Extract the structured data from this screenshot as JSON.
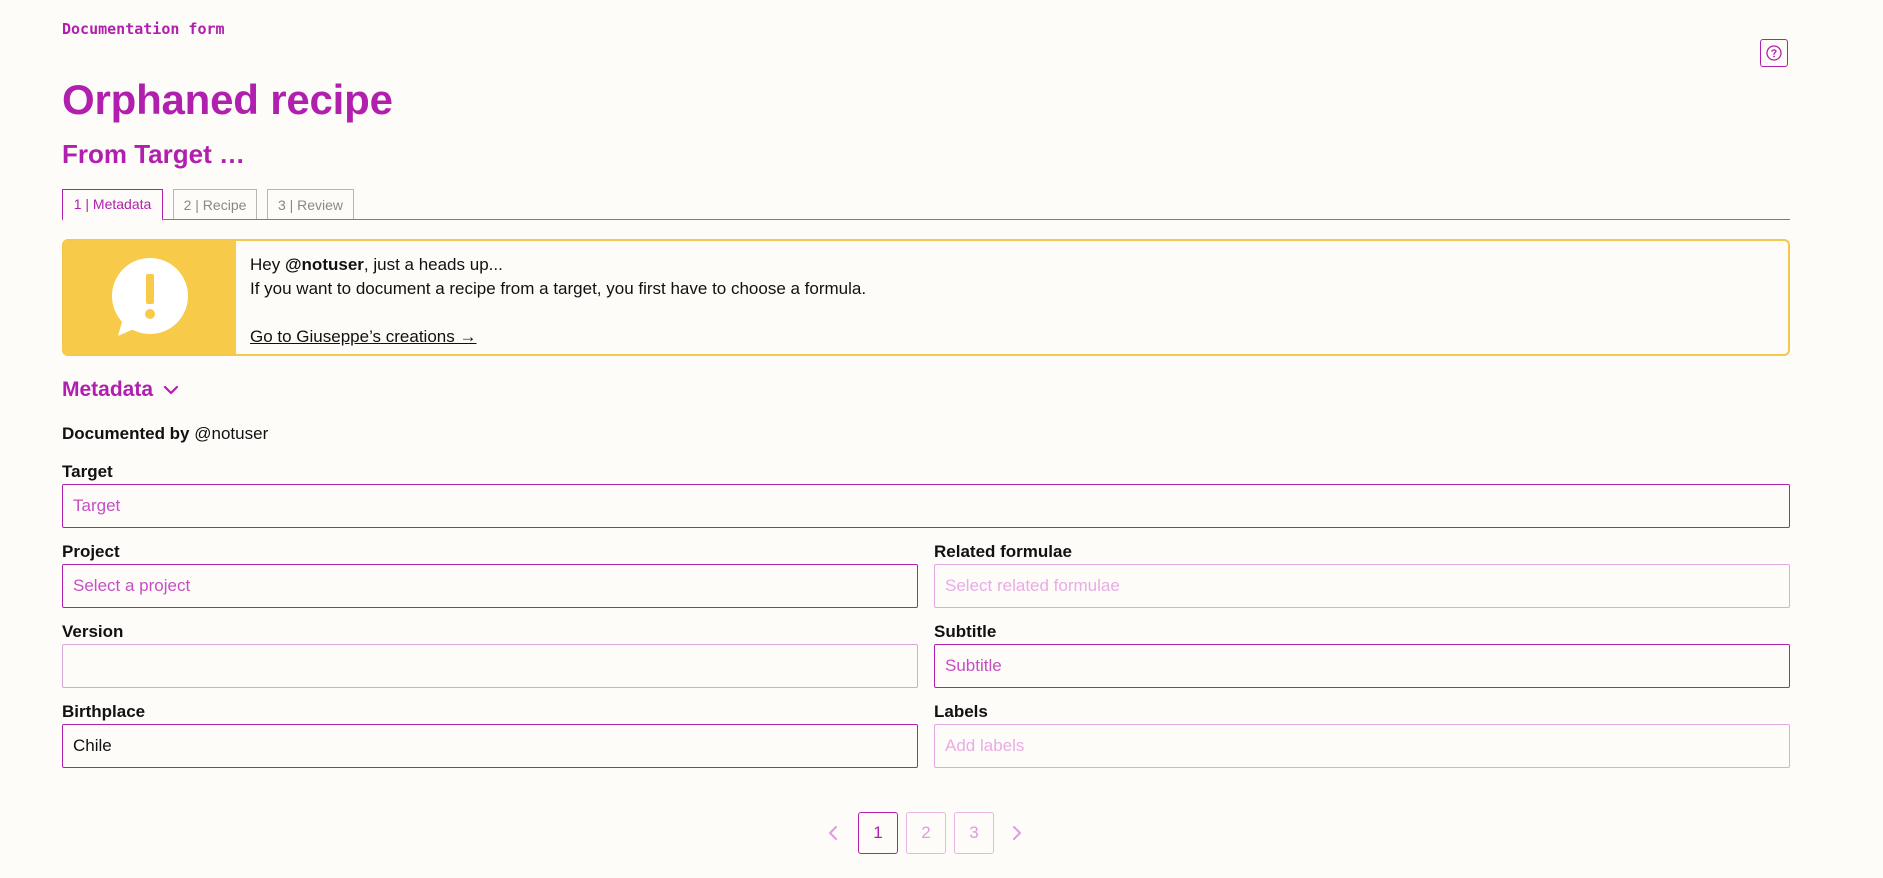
{
  "header": {
    "eyebrow": "Documentation form",
    "title": "Orphaned recipe",
    "subtitle": "From Target …",
    "help_icon": "question-circle-icon"
  },
  "tabs": [
    {
      "label": "1 | Metadata",
      "active": true
    },
    {
      "label": "2 | Recipe",
      "active": false
    },
    {
      "label": "3 | Review",
      "active": false
    }
  ],
  "alert": {
    "icon": "exclamation-bubble-icon",
    "greeting_prefix": "Hey ",
    "username": "@notuser",
    "greeting_suffix": ", just a heads up...",
    "message": "If you want to document a recipe from a target, you first have to choose a formula.",
    "link": "Go to Giuseppe’s creations →"
  },
  "section": {
    "title": "Metadata",
    "documented_by_label": "Documented by",
    "documented_by_user": "@notuser"
  },
  "form": {
    "target": {
      "label": "Target",
      "placeholder": "Target",
      "value": ""
    },
    "project": {
      "label": "Project",
      "placeholder": "Select a project",
      "value": ""
    },
    "related_formulae": {
      "label": "Related formulae",
      "placeholder": "Select related formulae",
      "value": ""
    },
    "version": {
      "label": "Version",
      "placeholder": "",
      "value": ""
    },
    "subtitle": {
      "label": "Subtitle",
      "placeholder": "Subtitle",
      "value": ""
    },
    "birthplace": {
      "label": "Birthplace",
      "placeholder": "",
      "value": "Chile"
    },
    "labels": {
      "label": "Labels",
      "placeholder": "Add labels",
      "value": ""
    }
  },
  "pagination": {
    "pages": [
      "1",
      "2",
      "3"
    ],
    "current": "1"
  },
  "colors": {
    "accent": "#b11fae",
    "warning": "#f7cb49",
    "background": "#fdfcf8"
  }
}
